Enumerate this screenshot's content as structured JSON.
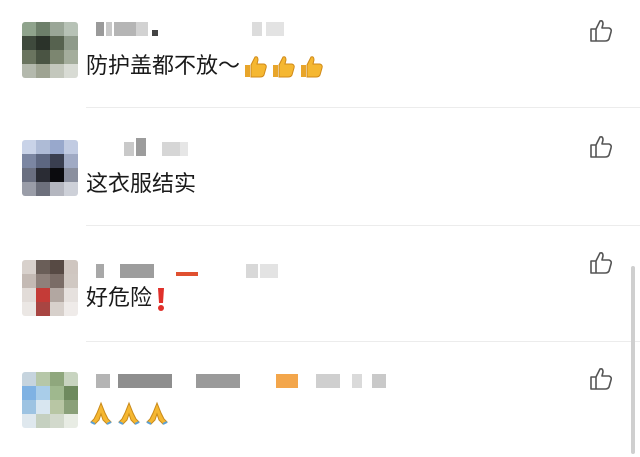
{
  "comments": [
    {
      "text": "防护盖都不放～",
      "emojis": [
        "thumbs-up-emoji",
        "thumbs-up-emoji",
        "thumbs-up-emoji"
      ],
      "like_icon": "thumbs-up-outline-icon"
    },
    {
      "text": "这衣服结实",
      "emojis": [],
      "like_icon": "thumbs-up-outline-icon"
    },
    {
      "text": "好危险",
      "emojis": [
        "red-exclamation-emoji"
      ],
      "like_icon": "thumbs-up-outline-icon"
    },
    {
      "text": "",
      "emojis": [
        "folded-hands-emoji",
        "folded-hands-emoji",
        "folded-hands-emoji"
      ],
      "like_icon": "thumbs-up-outline-icon"
    }
  ],
  "colors": {
    "text": "#1a1a1a",
    "icon": "#555555",
    "divider": "#ececec",
    "thumb_yellow": "#f5b731",
    "exclamation_red": "#e0302a",
    "scrollbar": "#cfcfcf"
  }
}
